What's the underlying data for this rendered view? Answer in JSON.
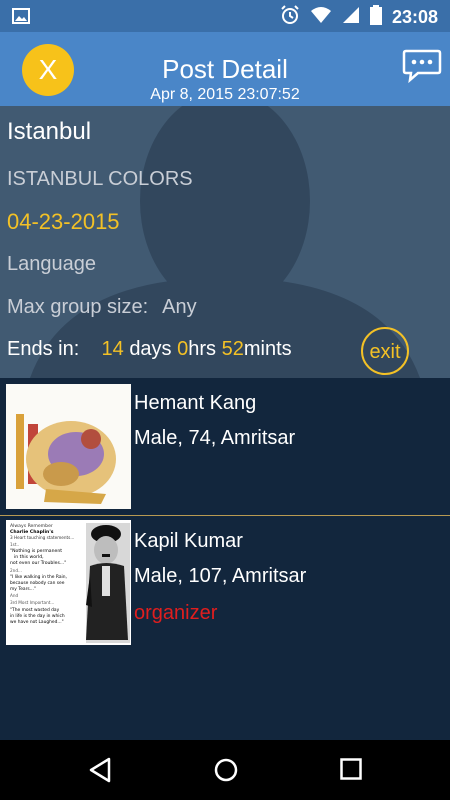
{
  "status_bar": {
    "time": "23:08",
    "icons": [
      "image-icon",
      "alarm-icon",
      "wifi-icon",
      "signal-icon",
      "battery-icon"
    ]
  },
  "header": {
    "close_label": "X",
    "title": "Post Detail",
    "subtitle": "Apr 8, 2015 23:07:52",
    "chat_icon": "chat-bubble-icon"
  },
  "post": {
    "title": "Istanbul",
    "subtitle": "ISTANBUL COLORS",
    "date": "04-23-2015",
    "language_label": "Language",
    "max_group_label": "Max group size:",
    "max_group_value": "Any",
    "ends_label": "Ends in:",
    "days": "14",
    "days_label": "days",
    "hrs": "0",
    "hrs_label": "hrs",
    "mins": "52",
    "mins_label": "mints",
    "exit_label": "exit"
  },
  "members": [
    {
      "name": "Hemant Kang",
      "info": "Male, 74, Amritsar",
      "role": ""
    },
    {
      "name": "Kapil Kumar",
      "info": "Male, 107, Amritsar",
      "role": "organizer"
    }
  ],
  "thumb_text": {
    "t1": "Always Remember",
    "t2": "Charlie Chaplin's",
    "t3": "3 Heart touching statements...",
    "t4": "1st..",
    "t5": "\"Nothing is permanent",
    "t6": "in this world,",
    "t7": "not even our Troubles...\"",
    "t8": "2nd...",
    "t9": "\"I like walking in the Rain,",
    "t10": "because nobody can see",
    "t11": "my Tears...\"",
    "t12": "And",
    "t13": "3rd Most Important...",
    "t14": "\"The most wasted day",
    "t15": "in life is the day in which",
    "t16": "we have not Laughed...\""
  },
  "colors": {
    "header": "#4a86c8",
    "accent": "#f3c126",
    "organizer": "#e01e1e",
    "list_bg": "#12263d"
  }
}
